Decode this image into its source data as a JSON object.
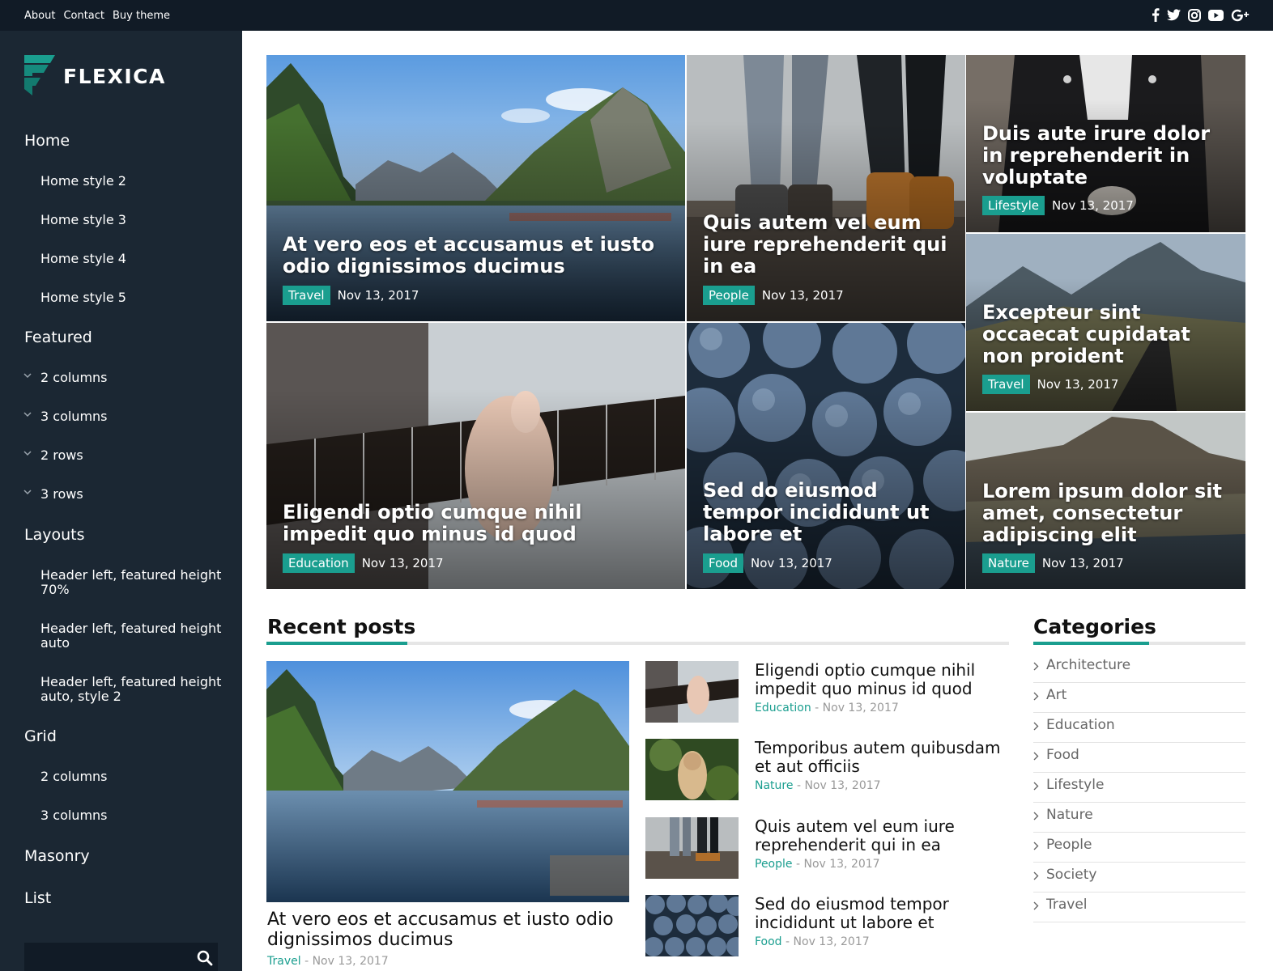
{
  "topbar": {
    "links": [
      "About",
      "Contact",
      "Buy theme"
    ],
    "social_icons": [
      "facebook-icon",
      "twitter-icon",
      "instagram-icon",
      "youtube-icon",
      "google-plus-icon"
    ]
  },
  "brand": {
    "name": "FLEXICA",
    "accent": "#1a9e8f"
  },
  "sidebar": {
    "items": [
      {
        "label": "Home"
      },
      {
        "label": "Home style 2"
      },
      {
        "label": "Home style 3"
      },
      {
        "label": "Home style 4"
      },
      {
        "label": "Home style 5"
      },
      {
        "label": "Featured"
      },
      {
        "label": "2 columns"
      },
      {
        "label": "3 columns"
      },
      {
        "label": "2 rows"
      },
      {
        "label": "3 rows"
      },
      {
        "label": "Layouts"
      },
      {
        "label": "Header left, featured height 70%"
      },
      {
        "label": "Header left, featured height auto"
      },
      {
        "label": "Header left, featured height auto, style 2"
      },
      {
        "label": "Grid"
      },
      {
        "label": "2 columns"
      },
      {
        "label": "3 columns"
      },
      {
        "label": "Masonry"
      },
      {
        "label": "List"
      }
    ],
    "search_placeholder": ""
  },
  "featured": [
    {
      "title": "At vero eos et accusamus et iusto odio dignissimos ducimus",
      "category": "Travel",
      "date": "Nov 13, 2017"
    },
    {
      "title": "Quis autem vel eum iure reprehenderit qui in ea",
      "category": "People",
      "date": "Nov 13, 2017"
    },
    {
      "title": "Duis aute irure dolor in reprehenderit in voluptate",
      "category": "Lifestyle",
      "date": "Nov 13, 2017"
    },
    {
      "title": "Excepteur sint occaecat cupidatat non proident",
      "category": "Travel",
      "date": "Nov 13, 2017"
    },
    {
      "title": "Eligendi optio cumque nihil impedit quo minus id quod",
      "category": "Education",
      "date": "Nov 13, 2017"
    },
    {
      "title": "Sed do eiusmod tempor incididunt ut labore et",
      "category": "Food",
      "date": "Nov 13, 2017"
    },
    {
      "title": "Lorem ipsum dolor sit amet, consectetur adipiscing elit",
      "category": "Nature",
      "date": "Nov 13, 2017"
    }
  ],
  "recent": {
    "heading": "Recent posts",
    "main": {
      "title": "At vero eos et accusamus et iusto odio dignissimos ducimus",
      "category": "Travel",
      "date": "- Nov 13, 2017"
    },
    "list": [
      {
        "title": "Eligendi optio cumque nihil impedit quo minus id quod",
        "category": "Education",
        "date": "- Nov 13, 2017"
      },
      {
        "title": "Temporibus autem quibusdam et aut officiis",
        "category": "Nature",
        "date": "- Nov 13, 2017"
      },
      {
        "title": "Quis autem vel eum iure reprehenderit qui in ea",
        "category": "People",
        "date": "- Nov 13, 2017"
      },
      {
        "title": "Sed do eiusmod tempor incididunt ut labore et",
        "category": "Food",
        "date": "- Nov 13, 2017"
      }
    ]
  },
  "categories": {
    "heading": "Categories",
    "items": [
      "Architecture",
      "Art",
      "Education",
      "Food",
      "Lifestyle",
      "Nature",
      "People",
      "Society",
      "Travel"
    ]
  }
}
